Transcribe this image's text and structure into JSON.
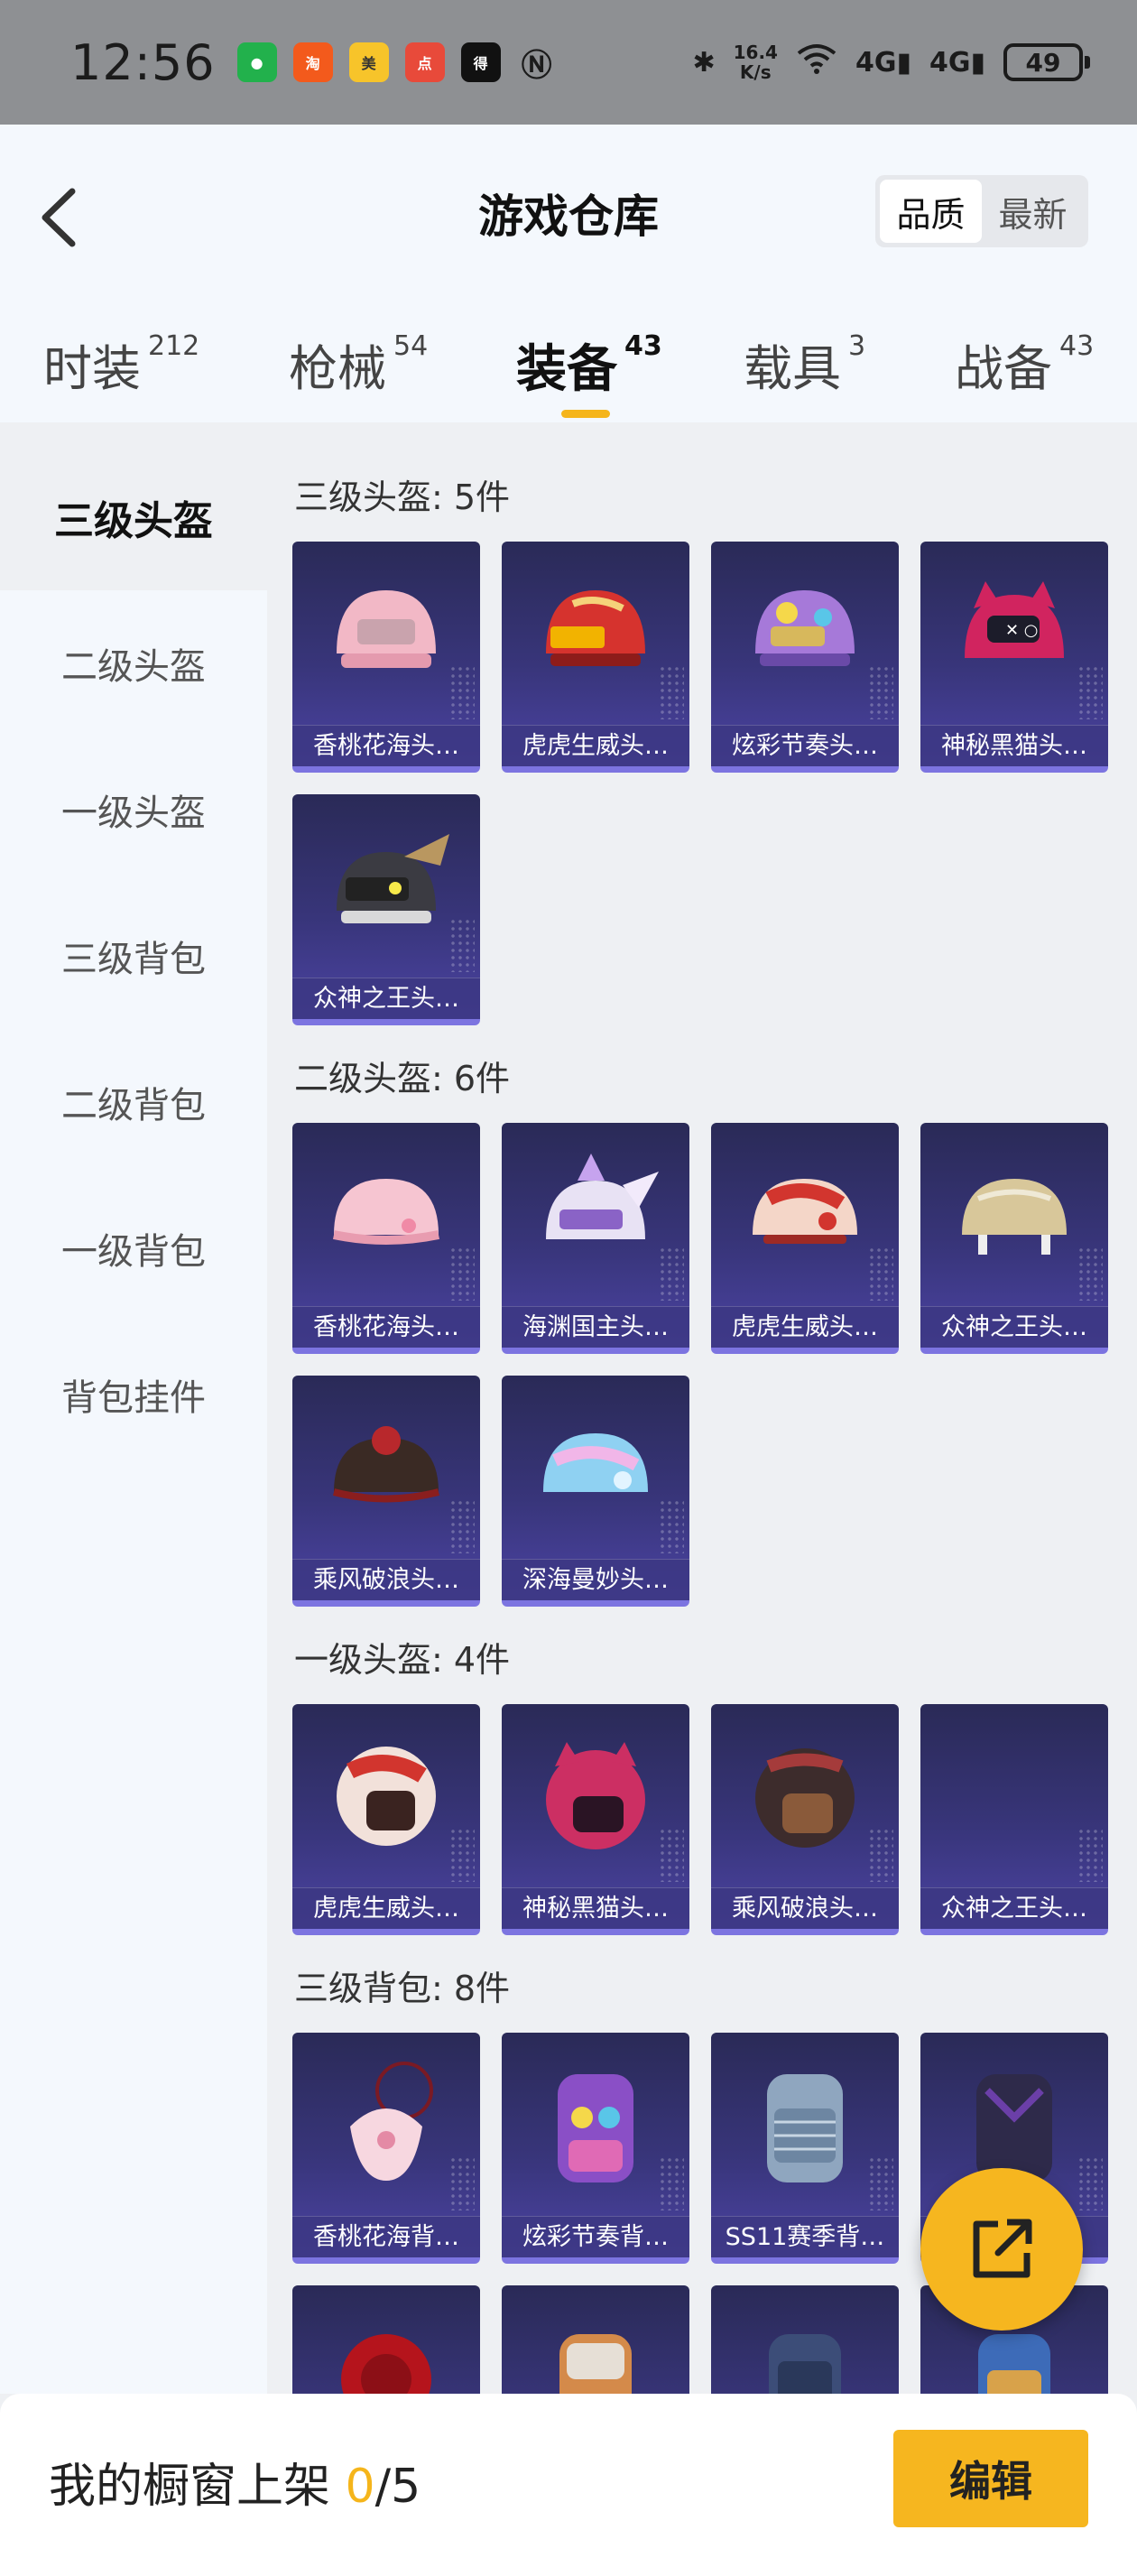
{
  "status_bar": {
    "time": "12:56",
    "net_speed_value": "16.4",
    "net_speed_unit": "K/s",
    "signal_1": "4G",
    "signal_2": "4G",
    "battery": "49",
    "apps": [
      "wechat-icon",
      "taobao-icon",
      "meituan-icon",
      "dianping-icon",
      "dewu-icon",
      "nfc-icon"
    ]
  },
  "header": {
    "title": "游戏仓库",
    "sort_options": [
      "品质",
      "最新"
    ],
    "sort_selected": "品质"
  },
  "category_tabs": [
    {
      "label": "时装",
      "count": "212"
    },
    {
      "label": "枪械",
      "count": "54"
    },
    {
      "label": "装备",
      "count": "43",
      "active": true
    },
    {
      "label": "载具",
      "count": "3"
    },
    {
      "label": "战备",
      "count": "43"
    }
  ],
  "sidebar": {
    "items": [
      "三级头盔",
      "二级头盔",
      "一级头盔",
      "三级背包",
      "二级背包",
      "一级背包",
      "背包挂件"
    ],
    "active": "三级头盔"
  },
  "sections": [
    {
      "title": "三级头盔: 5件",
      "items": [
        "香桃花海头…",
        "虎虎生威头…",
        "炫彩节奏头…",
        "神秘黑猫头…",
        "众神之王头…"
      ]
    },
    {
      "title": "二级头盔: 6件",
      "items": [
        "香桃花海头…",
        "海渊国主头…",
        "虎虎生威头…",
        "众神之王头…",
        "乘风破浪头…",
        "深海曼妙头…"
      ]
    },
    {
      "title": "一级头盔: 4件",
      "items": [
        "虎虎生威头…",
        "神秘黑猫头…",
        "乘风破浪头…",
        "众神之王头…"
      ]
    },
    {
      "title": "三级背包: 8件",
      "items": [
        "香桃花海背…",
        "炫彩节奏背…",
        "SS11赛季背…",
        "",
        "",
        "",
        "",
        ""
      ]
    }
  ],
  "bottom_bar": {
    "label": "我的橱窗上架",
    "count": "0",
    "total": "/5",
    "edit_label": "编辑"
  },
  "colors": {
    "accent": "#f6b61f",
    "card_bg": "#38357a",
    "status_bar": "#8e9093"
  }
}
